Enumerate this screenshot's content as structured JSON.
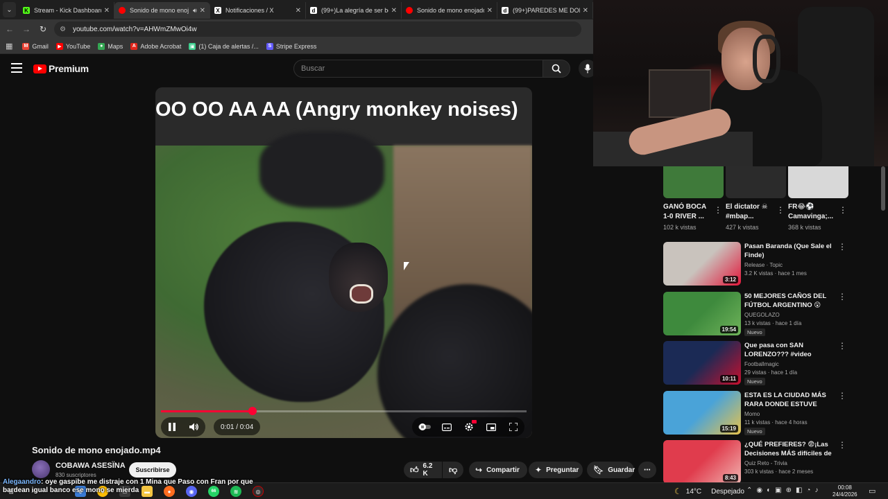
{
  "browser": {
    "tabs": [
      {
        "title": "Stream - Kick Dashboard",
        "fav_color": "#53fc18",
        "fav_glyph": "K",
        "active": false
      },
      {
        "title": "Sonido de mono enoj",
        "fav_color": "#ff0000",
        "fav_glyph": "",
        "active": true
      },
      {
        "title": "Notificaciones / X",
        "fav_color": "#ffffff",
        "fav_glyph": "X",
        "active": false
      },
      {
        "title": "(99+)La alegría de ser bo",
        "fav_color": "#ffffff",
        "fav_glyph": "d",
        "active": false
      },
      {
        "title": "Sonido de mono enojado",
        "fav_color": "#ff0000",
        "fav_glyph": "",
        "active": false
      },
      {
        "title": "(99+)PAREDES ME DOMC",
        "fav_color": "#ffffff",
        "fav_glyph": "d",
        "active": false
      }
    ],
    "url": "youtube.com/watch?v=AHWmZMwOi4w",
    "bookmarks": [
      {
        "label": "Gmail",
        "color": "#ea4335",
        "glyph": "M"
      },
      {
        "label": "YouTube",
        "color": "#ff0000",
        "glyph": "▶"
      },
      {
        "label": "Maps",
        "color": "#34a853",
        "glyph": "●"
      },
      {
        "label": "Adobe Acrobat",
        "color": "#e1251b",
        "glyph": "A"
      },
      {
        "label": "(1) Caja de alertas /...",
        "color": "#3ecf8e",
        "glyph": "▣"
      },
      {
        "label": "Stripe Express",
        "color": "#635bff",
        "glyph": "S"
      }
    ]
  },
  "youtube": {
    "logo_text": "Premium",
    "search_placeholder": "Buscar"
  },
  "video": {
    "caption": "OO OO AA AA (Angry monkey noises)",
    "time": "0:01 / 0:04",
    "progress_fraction": 0.25,
    "title": "Sonido de mono enojado.mp4",
    "channel": "COBAWA ASESÏNA",
    "subscribers": "830 suscriptores",
    "subscribe_label": "Suscribirse",
    "likes": "6.2 K",
    "share_label": "Compartir",
    "ask_label": "Preguntar",
    "save_label": "Guardar"
  },
  "chat": {
    "user": "Alegaandro",
    "line1": ": oye gaspibe me distraje con 1 Mina que Paso con Fran por que",
    "line2": "bardean igual banco ese mono se mierda"
  },
  "shorts": [
    {
      "title": "GANÓ BOCA 1-0 RIVER ...",
      "views": "102 k vistas",
      "thumb": "#3f7a3a"
    },
    {
      "title": "El dictator ☠ #mbap...",
      "views": "427 k vistas",
      "thumb": "#2b2b2b"
    },
    {
      "title": "FR😂⚽ Camavinga;...",
      "views": "368 k vistas",
      "thumb": "#d8d8d8"
    }
  ],
  "recommendations": [
    {
      "title": "Pasan Baranda (Que Sale el Finde)",
      "channel": "Release · Topic",
      "meta": "3.2 K vistas · hace 1 mes",
      "duration": "3:12",
      "badge": "",
      "thumb_a": "#c9c3bd",
      "thumb_b": "#e2173a"
    },
    {
      "title": "50 MEJORES CAÑOS DEL FÚTBOL ARGENTINO 😲",
      "channel": "QUEGOLAZO",
      "meta": "13 k vistas · hace 1 día",
      "duration": "19:54",
      "badge": "Nuevo",
      "thumb_a": "#3e8a3d",
      "thumb_b": "#6fb35a"
    },
    {
      "title": "Que pasa con SAN LORENZO??? #video #sanlorenzo #casla #afa",
      "channel": "Footballmagic",
      "meta": "29 vistas · hace 1 día",
      "duration": "10:11",
      "badge": "Nuevo",
      "thumb_a": "#1b2a55",
      "thumb_b": "#c8102e"
    },
    {
      "title": "ESTA ES LA CIUDAD MÁS RARA DONDE ESTUVE",
      "channel": "Momo",
      "meta": "11 k vistas · hace 4 horas",
      "duration": "15:19",
      "badge": "Nuevo",
      "thumb_a": "#4aa3d8",
      "thumb_b": "#e7c24b"
    },
    {
      "title": "¿QUÉ PREFIERES? 😨¡Las Decisiones MÁS difíciles de T...",
      "channel": "Quiz Reto - Trivia",
      "meta": "303 k vistas · hace 2 meses",
      "duration": "8:43",
      "badge": "",
      "thumb_a": "#e03c4d",
      "thumb_b": "#f1b3b0"
    }
  ],
  "taskbar": {
    "temperature": "14°C",
    "weather": "Despejado",
    "time": "00:08",
    "date": "24/4/2026",
    "badge": "66"
  }
}
